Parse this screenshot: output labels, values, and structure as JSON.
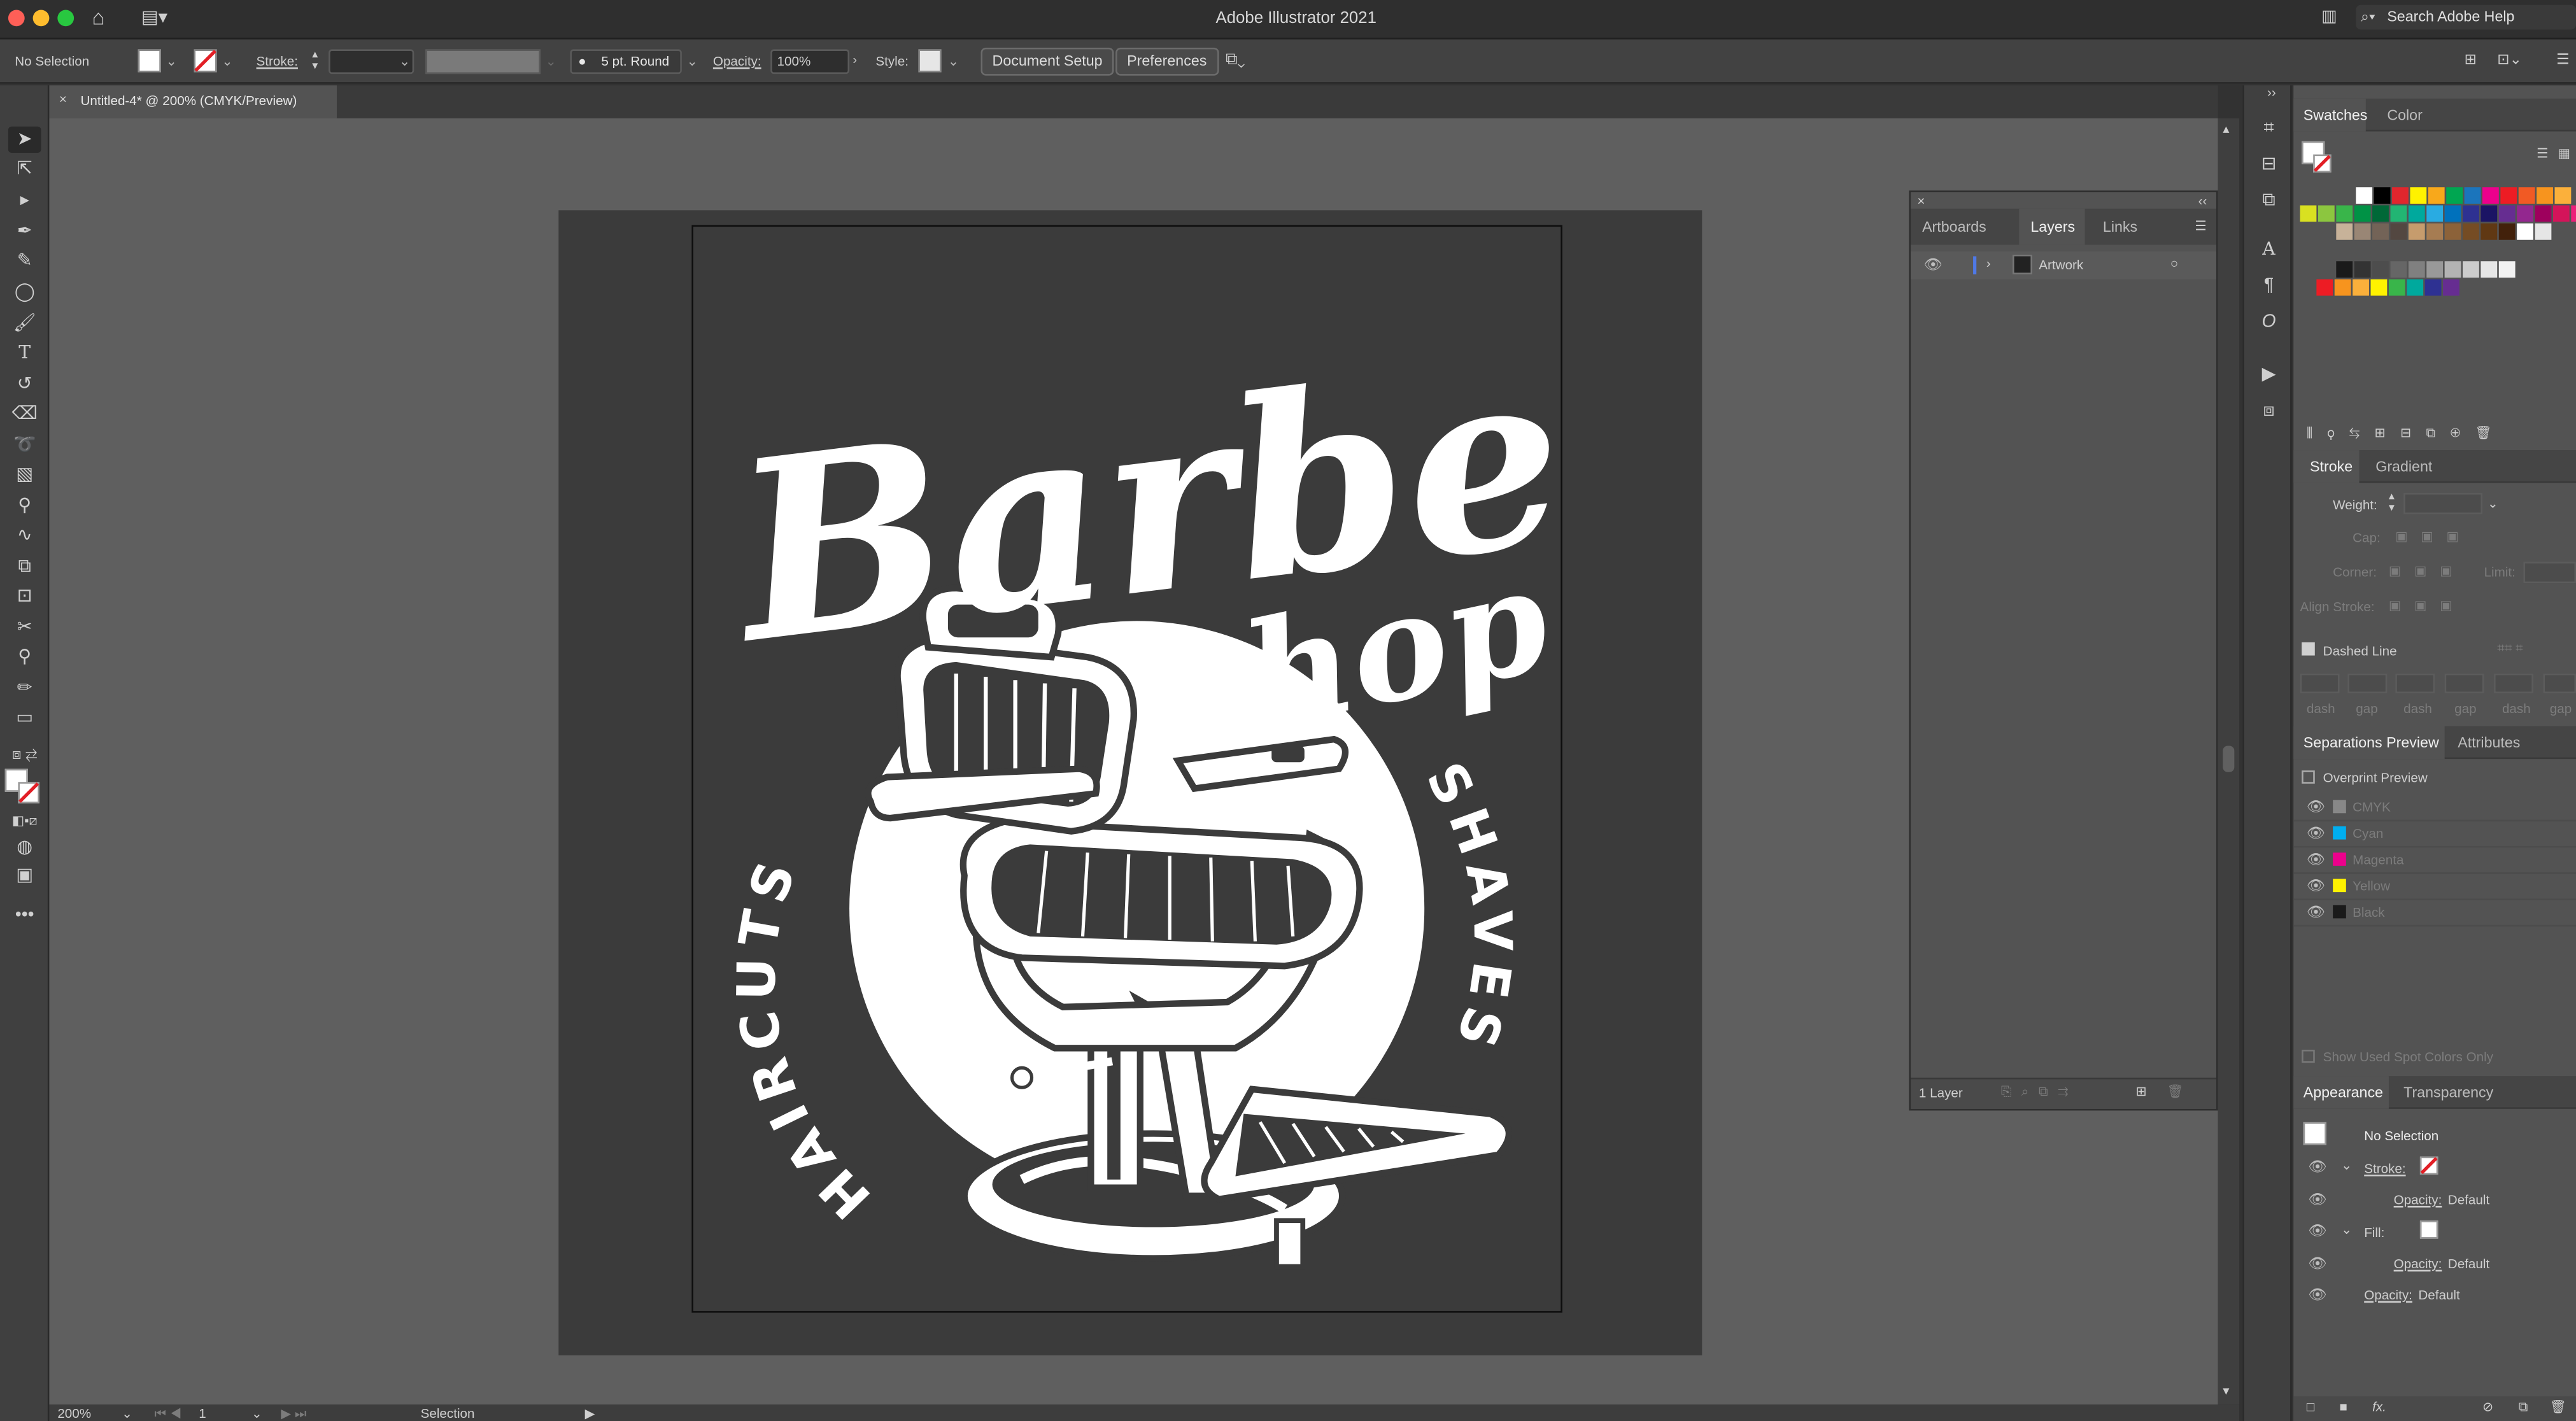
{
  "app": {
    "title": "Adobe Illustrator 2021",
    "search_placeholder": "Search Adobe Help"
  },
  "control_bar": {
    "selection_status": "No Selection",
    "stroke_label": "Stroke:",
    "brush_value": "5 pt. Round",
    "opacity_label": "Opacity:",
    "opacity_value": "100%",
    "style_label": "Style:",
    "document_setup_label": "Document Setup",
    "preferences_label": "Preferences"
  },
  "document": {
    "tab_title": "Untitled-4* @ 200% (CMYK/Preview)",
    "close_glyph": "×"
  },
  "artwork": {
    "title_script": "Barber",
    "subtitle_script": "shop",
    "left_arc_text": "HAIRCUTS",
    "right_arc_text": "SHAVES"
  },
  "status_bar": {
    "zoom": "200%",
    "artboard_number": "1",
    "tool_name": "Selection"
  },
  "layers_panel": {
    "tabs": [
      "Artboards",
      "Layers",
      "Links"
    ],
    "active_tab": "Layers",
    "layer_name": "Artwork",
    "footer_count": "1 Layer"
  },
  "swatches_panel": {
    "tabs": [
      "Swatches",
      "Color"
    ],
    "row1": [
      "#ffffff",
      "#000000",
      "#e0262d",
      "#fff200",
      "#f8a81b",
      "#00a651",
      "#1b75bc",
      "#ec008c",
      "#ed1c24",
      "#f15a24",
      "#f7941e",
      "#fbb03b"
    ],
    "row2": [
      "#d9e021",
      "#8cc63f",
      "#39b54a",
      "#009245",
      "#006837",
      "#22b573",
      "#00a99d",
      "#29abe2",
      "#0071bc",
      "#2e3192",
      "#1b1464",
      "#662d91",
      "#93278f",
      "#9e005d",
      "#d4145a",
      "#ed1e79"
    ],
    "row3": [
      "#c7b299",
      "#998675",
      "#736357",
      "#534741",
      "#c69c6d",
      "#a67c52",
      "#8c6239",
      "#754c24",
      "#603813",
      "#42210b",
      "#ffffff",
      "#e6e6e6"
    ],
    "row4": [
      "#1a1a1a",
      "#333333",
      "#4d4d4d",
      "#666666",
      "#808080",
      "#999999",
      "#b3b3b3",
      "#cccccc",
      "#e6e6e6",
      "#f2f2f2"
    ],
    "row5": [
      "#ed1c24",
      "#f7941e",
      "#fbb03b",
      "#fff200",
      "#39b54a",
      "#00a99d",
      "#2e3192",
      "#662d91"
    ]
  },
  "stroke_panel": {
    "tabs": [
      "Stroke",
      "Gradient"
    ],
    "weight_label": "Weight:",
    "cap_label": "Cap:",
    "corner_label": "Corner:",
    "limit_label": "Limit:",
    "align_label": "Align Stroke:",
    "dashed_label": "Dashed Line",
    "dash_labels": [
      "dash",
      "gap",
      "dash",
      "gap",
      "dash",
      "gap"
    ]
  },
  "separations_panel": {
    "tabs": [
      "Separations Preview",
      "Attributes"
    ],
    "overprint_label": "Overprint Preview",
    "inks": [
      {
        "name": "CMYK",
        "color": "#888888"
      },
      {
        "name": "Cyan",
        "color": "#00aeef"
      },
      {
        "name": "Magenta",
        "color": "#ec008c"
      },
      {
        "name": "Yellow",
        "color": "#fff200"
      },
      {
        "name": "Black",
        "color": "#1a1a1a"
      }
    ],
    "spot_label": "Show Used Spot Colors Only"
  },
  "appearance_panel": {
    "tabs": [
      "Appearance",
      "Transparency"
    ],
    "title": "No Selection",
    "stroke_label": "Stroke:",
    "fill_label": "Fill:",
    "opacity_label": "Opacity:",
    "opacity_value": "Default",
    "fx_label": "fx."
  }
}
